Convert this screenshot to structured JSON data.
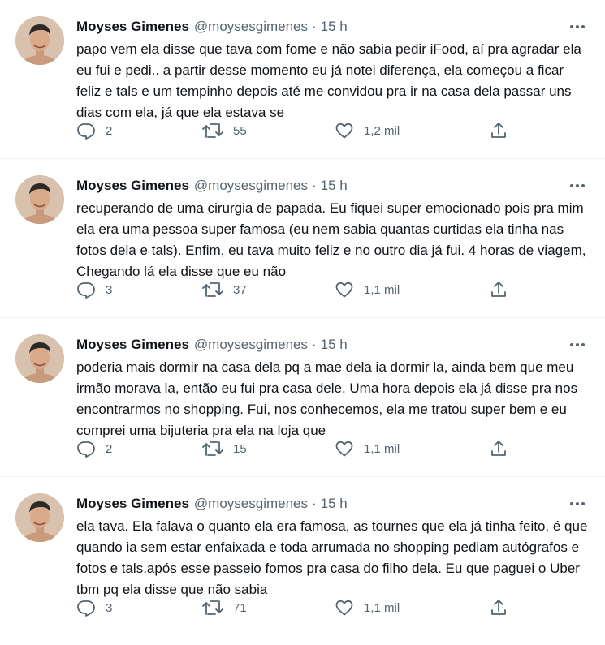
{
  "tweets": [
    {
      "name": "Moyses Gimenes",
      "handle": "@moysesgimenes",
      "separator": "·",
      "time": "15 h",
      "text": "papo vem ela disse que tava com fome e não sabia pedir iFood, aí pra agradar ela eu fui e pedi.. a partir desse momento eu já notei diferença, ela começou a ficar feliz e tals e um tempinho depois até me convidou pra ir na casa dela passar uns dias com ela, já que ela estava se",
      "replies": "2",
      "retweets": "55",
      "likes": "1,2 mil"
    },
    {
      "name": "Moyses Gimenes",
      "handle": "@moysesgimenes",
      "separator": "·",
      "time": "15 h",
      "text": "recuperando de uma cirurgia de papada. Eu fiquei super emocionado pois pra mim ela era uma pessoa super famosa (eu nem sabia quantas curtidas ela tinha nas fotos dela e tals). Enfim, eu tava muito feliz e no outro dia já fui. 4 horas de viagem, Chegando lá ela disse que eu não",
      "replies": "3",
      "retweets": "37",
      "likes": "1,1 mil"
    },
    {
      "name": "Moyses Gimenes",
      "handle": "@moysesgimenes",
      "separator": "·",
      "time": "15 h",
      "text": "poderia mais dormir na casa dela pq a mae dela ia dormir la, ainda bem que meu irmão morava la, então eu fui pra casa dele. Uma hora depois ela já disse pra nos encontrarmos no shopping. Fui, nos conhecemos, ela me tratou super bem e eu comprei uma bijuteria pra ela na loja que",
      "replies": "2",
      "retweets": "15",
      "likes": "1,1 mil"
    },
    {
      "name": "Moyses Gimenes",
      "handle": "@moysesgimenes",
      "separator": "·",
      "time": "15 h",
      "text": "ela tava. Ela falava o quanto ela era famosa, as tournes que ela já tinha feito, é que quando ia sem estar enfaixada e toda arrumada no shopping pediam autógrafos e fotos e tals.após esse passeio fomos pra casa do filho dela. Eu que paguei o Uber tbm pq ela disse que não sabia",
      "replies": "3",
      "retweets": "71",
      "likes": "1,1 mil"
    }
  ],
  "icons": {
    "more": "more-horizontal-icon",
    "reply": "reply-icon",
    "retweet": "retweet-icon",
    "like": "like-icon",
    "share": "share-icon"
  },
  "colors": {
    "text": "#0f1419",
    "secondary": "#536471",
    "divider": "#eff3f4"
  }
}
